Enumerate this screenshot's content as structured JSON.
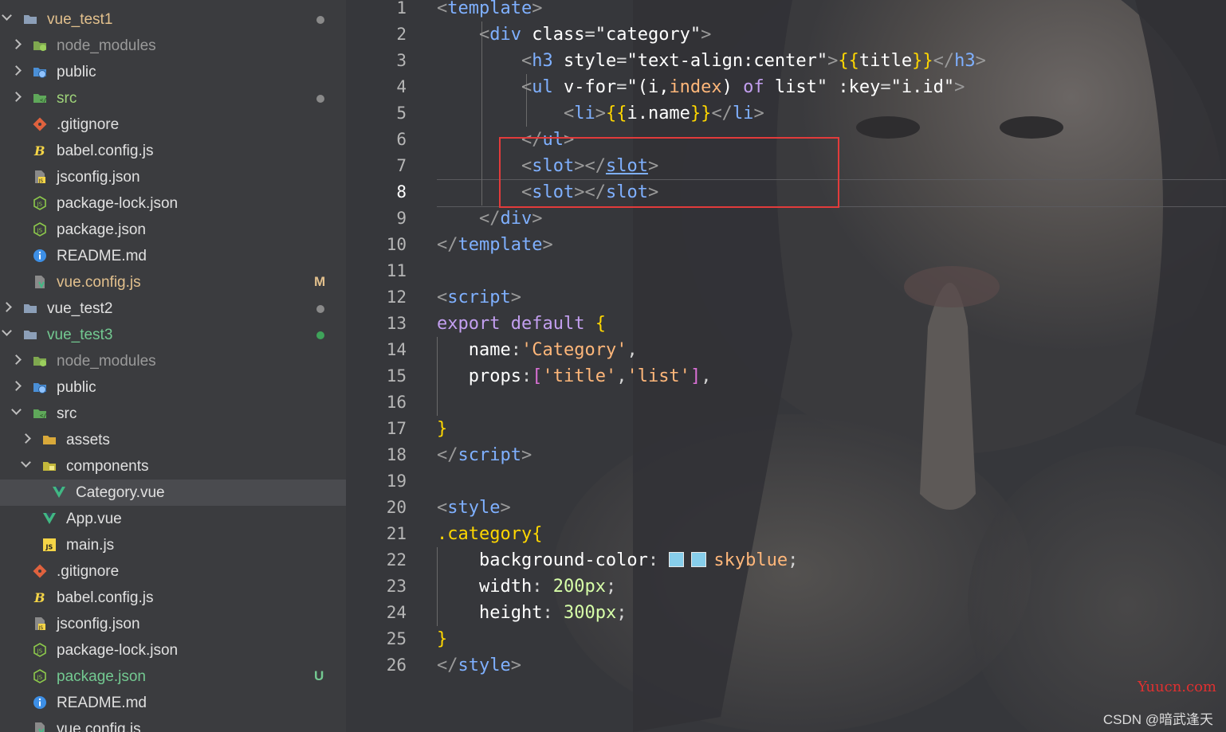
{
  "explorer": {
    "items": [
      {
        "label": "vue_test1",
        "depth": 0,
        "kind": "folder",
        "chevron": "expanded",
        "style": "modified",
        "badge": "dot",
        "badge_color": "#8a8a8a"
      },
      {
        "label": "node_modules",
        "depth": 1,
        "kind": "node-modules",
        "chevron": "collapsed",
        "style": "dim"
      },
      {
        "label": "public",
        "depth": 1,
        "kind": "public-folder",
        "chevron": "collapsed",
        "style": "normal"
      },
      {
        "label": "src",
        "depth": 1,
        "kind": "src-folder",
        "chevron": "collapsed",
        "style": "green",
        "badge": "dot",
        "badge_color": "#8a8a8a"
      },
      {
        "label": ".gitignore",
        "depth": 1,
        "kind": "git",
        "style": "normal"
      },
      {
        "label": "babel.config.js",
        "depth": 1,
        "kind": "babel",
        "style": "normal"
      },
      {
        "label": "jsconfig.json",
        "depth": 1,
        "kind": "jsconfig",
        "style": "normal"
      },
      {
        "label": "package-lock.json",
        "depth": 1,
        "kind": "node",
        "style": "normal"
      },
      {
        "label": "package.json",
        "depth": 1,
        "kind": "node",
        "style": "normal"
      },
      {
        "label": "README.md",
        "depth": 1,
        "kind": "info",
        "style": "normal"
      },
      {
        "label": "vue.config.js",
        "depth": 1,
        "kind": "vueconfig",
        "style": "modified",
        "badge": "M",
        "badge_color": "#e2c08d"
      },
      {
        "label": "vue_test2",
        "depth": 0,
        "kind": "folder",
        "chevron": "collapsed",
        "style": "normal",
        "badge": "dot",
        "badge_color": "#8a8a8a"
      },
      {
        "label": "vue_test3",
        "depth": 0,
        "kind": "folder",
        "chevron": "expanded",
        "style": "untracked",
        "badge": "dot",
        "badge_color": "#3fa35a"
      },
      {
        "label": "node_modules",
        "depth": 1,
        "kind": "node-modules",
        "chevron": "collapsed",
        "style": "dim"
      },
      {
        "label": "public",
        "depth": 1,
        "kind": "public-folder",
        "chevron": "collapsed",
        "style": "normal"
      },
      {
        "label": "src",
        "depth": 1,
        "kind": "src-folder",
        "chevron": "expanded",
        "style": "normal"
      },
      {
        "label": "assets",
        "depth": 2,
        "kind": "assets-folder",
        "chevron": "collapsed",
        "style": "normal"
      },
      {
        "label": "components",
        "depth": 2,
        "kind": "components-folder",
        "chevron": "expanded",
        "style": "normal"
      },
      {
        "label": "Category.vue",
        "depth": 3,
        "kind": "vue",
        "style": "normal",
        "selected": true
      },
      {
        "label": "App.vue",
        "depth": 2,
        "kind": "vue",
        "style": "normal"
      },
      {
        "label": "main.js",
        "depth": 2,
        "kind": "js",
        "style": "normal"
      },
      {
        "label": ".gitignore",
        "depth": 1,
        "kind": "git",
        "style": "normal"
      },
      {
        "label": "babel.config.js",
        "depth": 1,
        "kind": "babel",
        "style": "normal"
      },
      {
        "label": "jsconfig.json",
        "depth": 1,
        "kind": "jsconfig",
        "style": "normal"
      },
      {
        "label": "package-lock.json",
        "depth": 1,
        "kind": "node",
        "style": "normal"
      },
      {
        "label": "package.json",
        "depth": 1,
        "kind": "node",
        "style": "untracked",
        "badge": "U",
        "badge_color": "#73c991"
      },
      {
        "label": "README.md",
        "depth": 1,
        "kind": "info",
        "style": "normal"
      },
      {
        "label": "vue.config.js",
        "depth": 1,
        "kind": "vueconfig",
        "style": "normal"
      }
    ]
  },
  "editor": {
    "active_line": 8,
    "lines": [
      {
        "n": 1,
        "tokens": [
          [
            "punct",
            "<"
          ],
          [
            "tag",
            "template"
          ],
          [
            "punct",
            ">"
          ]
        ]
      },
      {
        "n": 2,
        "tokens": [
          [
            "default",
            "    "
          ],
          [
            "punct",
            "<"
          ],
          [
            "tag",
            "div"
          ],
          [
            "default",
            " "
          ],
          [
            "attr",
            "class"
          ],
          [
            "default",
            "="
          ],
          [
            "str",
            "\"category\""
          ],
          [
            "punct",
            ">"
          ]
        ]
      },
      {
        "n": 3,
        "tokens": [
          [
            "default",
            "        "
          ],
          [
            "punct",
            "<"
          ],
          [
            "tag",
            "h3"
          ],
          [
            "default",
            " "
          ],
          [
            "attr",
            "style"
          ],
          [
            "default",
            "="
          ],
          [
            "str",
            "\"text-align:center\""
          ],
          [
            "punct",
            ">"
          ],
          [
            "brace",
            "{{"
          ],
          [
            "tpl",
            "title"
          ],
          [
            "brace",
            "}}"
          ],
          [
            "punct",
            "</"
          ],
          [
            "tag",
            "h3"
          ],
          [
            "punct",
            ">"
          ]
        ]
      },
      {
        "n": 4,
        "tokens": [
          [
            "default",
            "        "
          ],
          [
            "punct",
            "<"
          ],
          [
            "tag",
            "ul"
          ],
          [
            "default",
            " "
          ],
          [
            "attr",
            "v-for"
          ],
          [
            "default",
            "="
          ],
          [
            "str",
            "\"(i,"
          ],
          [
            "val",
            "index"
          ],
          [
            "str",
            ") "
          ],
          [
            "kw",
            "of"
          ],
          [
            "str",
            " list\""
          ],
          [
            "default",
            " "
          ],
          [
            "attr",
            ":key"
          ],
          [
            "default",
            "="
          ],
          [
            "str",
            "\"i.id\""
          ],
          [
            "punct",
            ">"
          ]
        ]
      },
      {
        "n": 5,
        "tokens": [
          [
            "default",
            "            "
          ],
          [
            "punct",
            "<"
          ],
          [
            "tag",
            "li"
          ],
          [
            "punct",
            ">"
          ],
          [
            "brace",
            "{{"
          ],
          [
            "tpl",
            "i.name"
          ],
          [
            "brace",
            "}}"
          ],
          [
            "punct",
            "</"
          ],
          [
            "tag",
            "li"
          ],
          [
            "punct",
            ">"
          ]
        ]
      },
      {
        "n": 6,
        "tokens": [
          [
            "default",
            "        "
          ],
          [
            "punct",
            "</"
          ],
          [
            "tag",
            "ul"
          ],
          [
            "punct",
            ">"
          ]
        ]
      },
      {
        "n": 7,
        "tokens": [
          [
            "default",
            "        "
          ],
          [
            "punct",
            "<"
          ],
          [
            "tag",
            "slot"
          ],
          [
            "punct",
            "></"
          ],
          [
            "tag-u",
            "slot"
          ],
          [
            "punct",
            ">"
          ]
        ]
      },
      {
        "n": 8,
        "tokens": [
          [
            "default",
            "        "
          ],
          [
            "punct",
            "<"
          ],
          [
            "tag",
            "slot"
          ],
          [
            "punct",
            "></"
          ],
          [
            "tag",
            "slot"
          ],
          [
            "punct",
            ">"
          ]
        ]
      },
      {
        "n": 9,
        "tokens": [
          [
            "default",
            "    "
          ],
          [
            "punct",
            "</"
          ],
          [
            "tag",
            "div"
          ],
          [
            "punct",
            ">"
          ]
        ]
      },
      {
        "n": 10,
        "tokens": [
          [
            "punct",
            "</"
          ],
          [
            "tag",
            "template"
          ],
          [
            "punct",
            ">"
          ]
        ]
      },
      {
        "n": 11,
        "tokens": []
      },
      {
        "n": 12,
        "tokens": [
          [
            "punct",
            "<"
          ],
          [
            "tag",
            "script"
          ],
          [
            "punct",
            ">"
          ]
        ]
      },
      {
        "n": 13,
        "tokens": [
          [
            "kw",
            "export"
          ],
          [
            "default",
            " "
          ],
          [
            "kw",
            "default"
          ],
          [
            "default",
            " "
          ],
          [
            "brace",
            "{"
          ]
        ]
      },
      {
        "n": 14,
        "tokens": [
          [
            "default",
            "   "
          ],
          [
            "prop",
            "name"
          ],
          [
            "default",
            ":"
          ],
          [
            "val",
            "'Category'"
          ],
          [
            "default",
            ","
          ]
        ]
      },
      {
        "n": 15,
        "tokens": [
          [
            "default",
            "   "
          ],
          [
            "prop",
            "props"
          ],
          [
            "default",
            ":"
          ],
          [
            "bracket",
            "["
          ],
          [
            "val",
            "'title'"
          ],
          [
            "default",
            ","
          ],
          [
            "val",
            "'list'"
          ],
          [
            "bracket",
            "]"
          ],
          [
            "default",
            ","
          ]
        ]
      },
      {
        "n": 16,
        "tokens": []
      },
      {
        "n": 17,
        "tokens": [
          [
            "brace",
            "}"
          ]
        ]
      },
      {
        "n": 18,
        "tokens": [
          [
            "punct",
            "</"
          ],
          [
            "tag",
            "script"
          ],
          [
            "punct",
            ">"
          ]
        ]
      },
      {
        "n": 19,
        "tokens": []
      },
      {
        "n": 20,
        "tokens": [
          [
            "punct",
            "<"
          ],
          [
            "tag",
            "style"
          ],
          [
            "punct",
            ">"
          ]
        ]
      },
      {
        "n": 21,
        "tokens": [
          [
            "sel",
            ".category"
          ],
          [
            "brace",
            "{"
          ]
        ]
      },
      {
        "n": 22,
        "tokens": [
          [
            "default",
            "    "
          ],
          [
            "prop",
            "background-color"
          ],
          [
            "default",
            ": "
          ],
          [
            "swatch",
            ""
          ],
          [
            "val",
            "skyblue"
          ],
          [
            "default",
            ";"
          ]
        ]
      },
      {
        "n": 23,
        "tokens": [
          [
            "default",
            "    "
          ],
          [
            "prop",
            "width"
          ],
          [
            "default",
            ": "
          ],
          [
            "num",
            "200px"
          ],
          [
            "default",
            ";"
          ]
        ]
      },
      {
        "n": 24,
        "tokens": [
          [
            "default",
            "    "
          ],
          [
            "prop",
            "height"
          ],
          [
            "default",
            ": "
          ],
          [
            "num",
            "300px"
          ],
          [
            "default",
            ";"
          ]
        ]
      },
      {
        "n": 25,
        "tokens": [
          [
            "brace",
            "}"
          ]
        ]
      },
      {
        "n": 26,
        "tokens": [
          [
            "punct",
            "</"
          ],
          [
            "tag",
            "style"
          ],
          [
            "punct",
            ">"
          ]
        ]
      }
    ]
  },
  "watermarks": {
    "site": "Yuucn.com",
    "author": "CSDN @暗武逢天"
  },
  "colors": {
    "highlight_box": "#e23b3b",
    "swatch": "#87ceeb"
  }
}
